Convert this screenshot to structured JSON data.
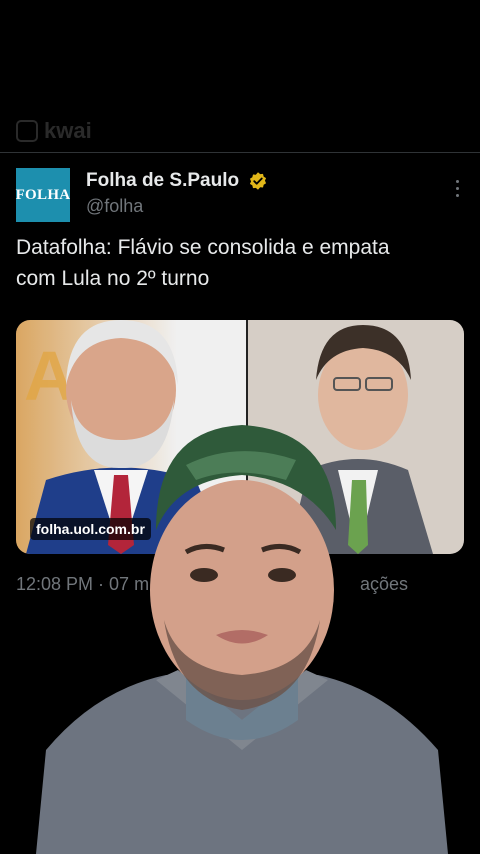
{
  "watermark": {
    "text": "kwai"
  },
  "tweet": {
    "avatar_text": "FOLHA",
    "author_name": "Folha de S.Paulo",
    "handle": "@folha",
    "text_lines": [
      "Datafolha: Flávio se consolida e empata",
      "com Lula no 2º turno"
    ],
    "link_label": "folha.uol.com.br",
    "timestamp": "12:08 PM · 07 m",
    "views_fragment": "ações"
  },
  "colors": {
    "background": "#000000",
    "text_primary": "#e7e9ea",
    "text_secondary": "#71767b",
    "verified_gold": "#e2b719",
    "avatar_bg": "#1d8fae"
  }
}
